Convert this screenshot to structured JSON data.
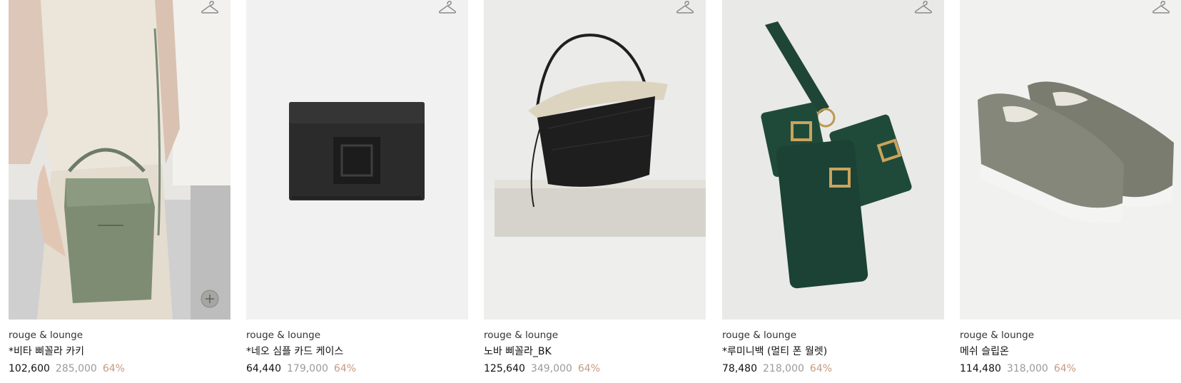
{
  "products": [
    {
      "brand": "rouge & lounge",
      "name": "*비타 삐꼴라 카키",
      "price": "102,600",
      "original_price": "285,000",
      "discount": "64%",
      "image": "khaki-bucket-bag-on-model"
    },
    {
      "brand": "rouge & lounge",
      "name": "*네오 심플 카드 케이스",
      "price": "64,440",
      "original_price": "179,000",
      "discount": "64%",
      "image": "black-card-case"
    },
    {
      "brand": "rouge & lounge",
      "name": "노바 삐꼴라_BK",
      "price": "125,640",
      "original_price": "349,000",
      "discount": "64%",
      "image": "black-croc-bucket-bag"
    },
    {
      "brand": "rouge & lounge",
      "name": "*루미니백 (멀티 폰 월렛)",
      "price": "78,480",
      "original_price": "218,000",
      "discount": "64%",
      "image": "green-croc-multi-phone-wallet"
    },
    {
      "brand": "rouge & lounge",
      "name": "메쉬 슬립온",
      "price": "114,480",
      "original_price": "318,000",
      "discount": "64%",
      "image": "khaki-woven-slip-on-shoes"
    }
  ],
  "icons": {
    "wishlist": "hanger-icon",
    "quick_add": "plus-icon"
  },
  "colors": {
    "discount": "#c79a7e",
    "original_price": "#9a9a9a",
    "price": "#111111"
  }
}
